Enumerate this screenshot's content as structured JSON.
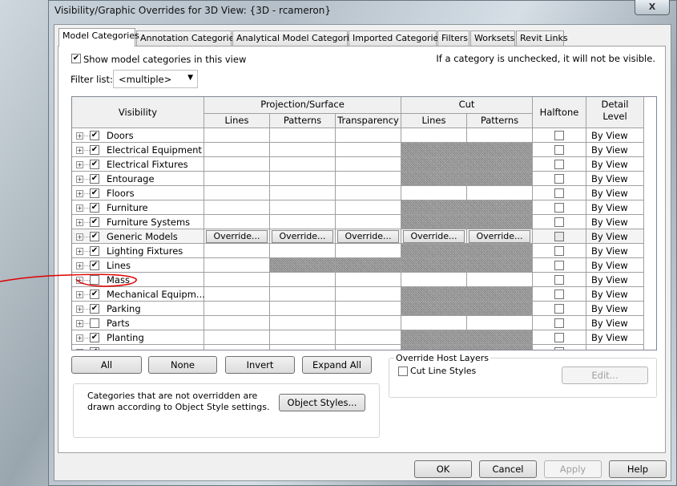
{
  "window": {
    "title": "Visibility/Graphic Overrides for 3D View: {3D - rcameron}",
    "close_label": "X"
  },
  "tabs": [
    "Model Categories",
    "Annotation Categories",
    "Analytical Model Categories",
    "Imported Categories",
    "Filters",
    "Worksets",
    "Revit Links"
  ],
  "show_categories": {
    "label": "Show model categories in this view",
    "checked": true
  },
  "hint": "If a category is unchecked, it will not be visible.",
  "filter": {
    "label": "Filter list:",
    "value": "<multiple>"
  },
  "grid": {
    "headers": {
      "visibility": "Visibility",
      "projection": "Projection/Surface",
      "cut": "Cut",
      "halftone": "Halftone",
      "detail": "Detail Level",
      "lines": "Lines",
      "patterns": "Patterns",
      "transparency": "Transparency"
    },
    "override_label": "Override...",
    "rows": [
      {
        "name": "Doors",
        "checked": true,
        "hatch": [],
        "detail": "By View"
      },
      {
        "name": "Electrical Equipment",
        "checked": true,
        "hatch": [
          "cut_lines",
          "cut_patterns"
        ],
        "detail": "By View"
      },
      {
        "name": "Electrical Fixtures",
        "checked": true,
        "hatch": [
          "cut_lines",
          "cut_patterns"
        ],
        "detail": "By View"
      },
      {
        "name": "Entourage",
        "checked": true,
        "hatch": [
          "cut_lines",
          "cut_patterns"
        ],
        "detail": "By View"
      },
      {
        "name": "Floors",
        "checked": true,
        "hatch": [],
        "detail": "By View"
      },
      {
        "name": "Furniture",
        "checked": true,
        "hatch": [
          "cut_lines",
          "cut_patterns"
        ],
        "detail": "By View"
      },
      {
        "name": "Furniture Systems",
        "checked": true,
        "hatch": [
          "cut_lines",
          "cut_patterns"
        ],
        "detail": "By View"
      },
      {
        "name": "Generic Models",
        "checked": true,
        "selected": true,
        "hatch": [],
        "detail": "By View"
      },
      {
        "name": "Lighting Fixtures",
        "checked": true,
        "hatch": [
          "cut_lines",
          "cut_patterns"
        ],
        "detail": "By View"
      },
      {
        "name": "Lines",
        "checked": true,
        "hatch": [
          "proj_patterns",
          "proj_transparency",
          "cut_lines",
          "cut_patterns"
        ],
        "detail": "By View"
      },
      {
        "name": "Mass",
        "checked": false,
        "hatch": [],
        "detail": "By View"
      },
      {
        "name": "Mechanical Equipm...",
        "checked": true,
        "hatch": [
          "cut_lines",
          "cut_patterns"
        ],
        "detail": "By View"
      },
      {
        "name": "Parking",
        "checked": true,
        "hatch": [
          "cut_lines",
          "cut_patterns"
        ],
        "detail": "By View"
      },
      {
        "name": "Parts",
        "checked": false,
        "hatch": [],
        "detail": "By View"
      },
      {
        "name": "Planting",
        "checked": true,
        "hatch": [
          "cut_lines",
          "cut_patterns"
        ],
        "detail": "By View"
      }
    ]
  },
  "buttons": {
    "all": "All",
    "none": "None",
    "invert": "Invert",
    "expand_all": "Expand All",
    "object_styles": "Object Styles...",
    "edit": "Edit...",
    "ok": "OK",
    "cancel": "Cancel",
    "apply": "Apply",
    "help": "Help"
  },
  "note": "Categories that are not overridden are drawn according to Object Style settings.",
  "host_layers": {
    "title": "Override Host Layers",
    "cut_line_styles": "Cut Line Styles",
    "checked": false
  },
  "annotation_color": "#e00000"
}
